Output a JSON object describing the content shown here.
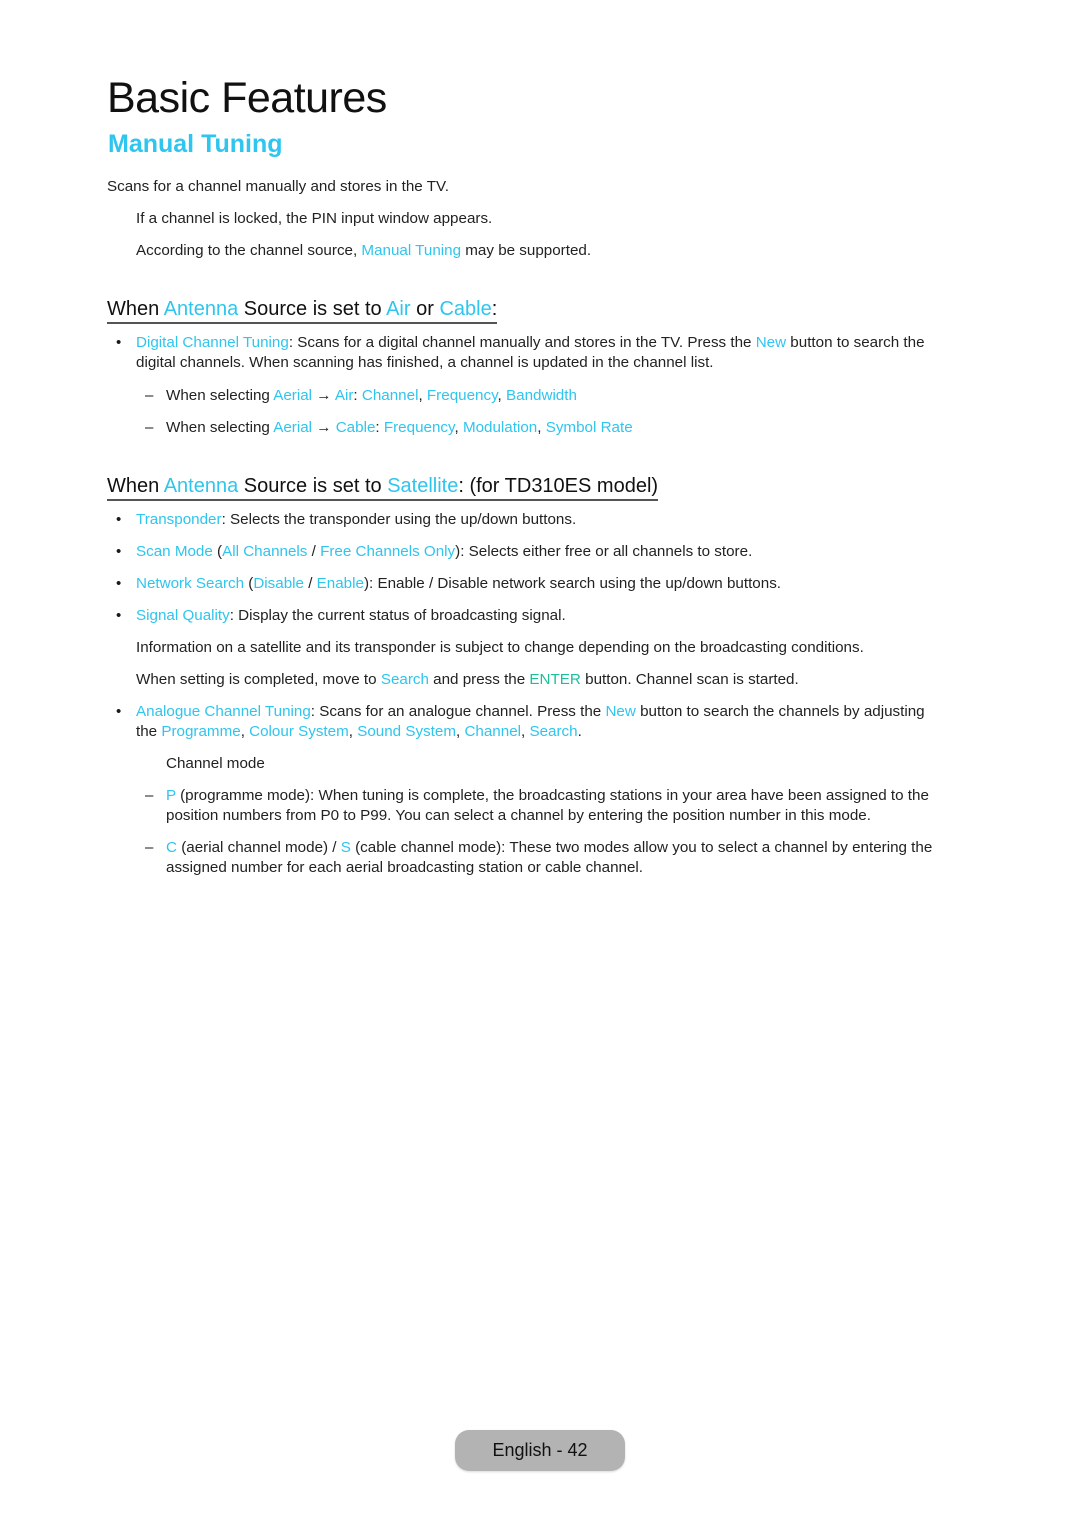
{
  "page": {
    "title": "Basic Features",
    "section_title": "Manual Tuning"
  },
  "intro": {
    "text": "Scans for a channel manually and stores in the TV.",
    "note1": "If a channel is locked, the PIN input window appears.",
    "note2_pre": "According to the channel source, ",
    "note2_hl": "Manual Tuning",
    "note2_post": " may be supported."
  },
  "air_cable": {
    "heading": {
      "w1": "When ",
      "hl1": "Antenna",
      "w2": " Source is set to ",
      "hl2": "Air",
      "w3": " or ",
      "hl3": "Cable",
      "w4": ":"
    },
    "bullet_symbol": "•",
    "digital": {
      "term": "Digital Channel Tuning",
      "t1": ": Scans for a digital channel manually and stores in the TV. Press the ",
      "new": "New",
      "t2": " button to search the digital channels. When scanning has finished, a channel is updated in the channel list."
    },
    "dash_symbol": "–",
    "air_line": {
      "pre": "When selecting ",
      "aerial": "Aerial",
      "arrow": " → ",
      "source": "Air",
      "colon": ": ",
      "o1": "Channel",
      "o2": "Frequency",
      "o3": "Bandwidth"
    },
    "cable_line": {
      "pre": "When selecting ",
      "aerial": "Aerial",
      "arrow": " → ",
      "source": "Cable",
      "colon": ": ",
      "o1": "Frequency",
      "o2": "Modulation",
      "o3": "Symbol Rate"
    }
  },
  "satellite": {
    "heading": {
      "w1": "When ",
      "hl1": "Antenna",
      "w2": " Source is set to ",
      "hl2": "Satellite",
      "w3": ": (for TD310ES model)"
    },
    "transponder": {
      "term": "Transponder",
      "text": ": Selects the transponder using the up/down buttons."
    },
    "scan_mode": {
      "term": "Scan Mode",
      "open": " (",
      "o1": "All Channels",
      "sep": " / ",
      "o2": "Free Channels Only",
      "text": "): Selects either free or all channels to store."
    },
    "network_search": {
      "term": "Network Search",
      "open": " (",
      "o1": "Disable",
      "sep": " / ",
      "o2": "Enable",
      "text": "): Enable / Disable network search using the up/down buttons."
    },
    "signal_quality": {
      "term": "Signal Quality",
      "text": ": Display the current status of broadcasting signal."
    },
    "note1": "Information on a satellite and its transponder is subject to change depending on the broadcasting conditions.",
    "note2": {
      "pre": "When setting is completed, move to ",
      "search": "Search",
      "mid": " and press the ",
      "enter": "ENTER",
      "post": " button. Channel scan is started."
    }
  },
  "analogue": {
    "term": "Analogue Channel Tuning",
    "t1": ": Scans for an analogue channel. Press the ",
    "new": "New",
    "t2": " button to search the channels by adjusting the ",
    "o1": "Programme",
    "o2": "Colour System",
    "o3": "Sound System",
    "o4": "Channel",
    "o5": "Search",
    "comma": ", ",
    "end": ".",
    "channel_mode_label": "Channel mode",
    "p_mode": {
      "letter": "P",
      "text": " (programme mode): When tuning is complete, the broadcasting stations in your area have been assigned to the position numbers from P0 to P99. You can select a channel by entering the position number in this mode."
    },
    "cs_mode": {
      "c": "C",
      "t1": " (aerial channel mode) / ",
      "s": "S",
      "t2": " (cable channel mode): These two modes allow you to select a channel by entering the assigned number for each aerial broadcasting station or cable channel."
    }
  },
  "footer": {
    "page_label": "English - 42"
  },
  "colors": {
    "accent": "#2ec5ee",
    "enter_green": "#1dbf9a",
    "badge": "#b3b3b3"
  }
}
